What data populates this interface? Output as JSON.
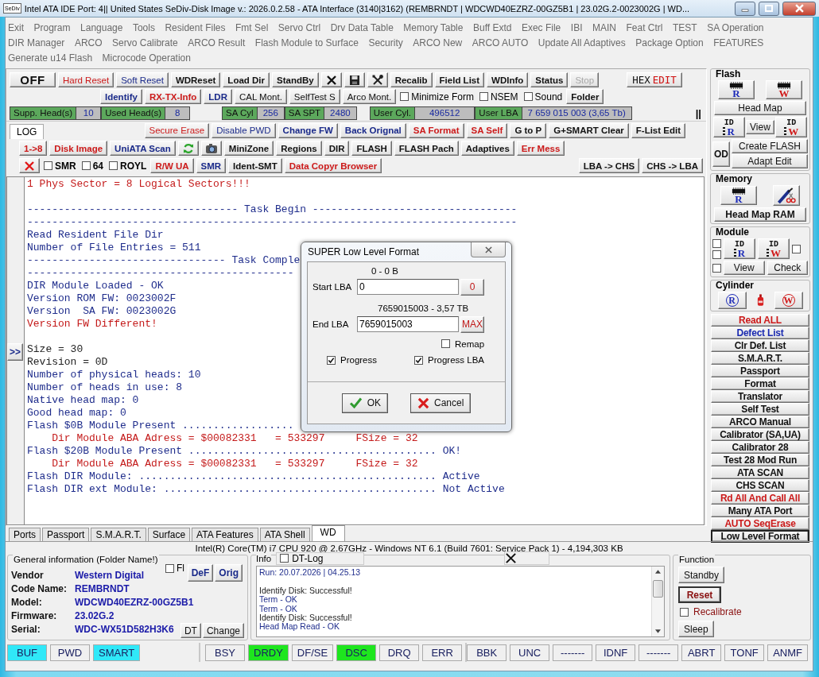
{
  "window": {
    "icon_label": "SeDiv",
    "title": "Intel ATA IDE  Port: 4|| United States  SeDiv-Disk Image v.: 2026.0.2.58 - ATA Interface (3140|3162)  (REMBRNDT | WDCWD40EZRZ-00GZ5B1 | 23.02G.2-0023002G | WD..."
  },
  "menu": [
    [
      "Exit",
      "Program",
      "Language",
      "Tools",
      "Resident Files",
      "Fmt Sel",
      "Servo Ctrl",
      "Drv Data Table",
      "Memory Table",
      "Buff Extd",
      "Exec File",
      "IBI",
      "MAIN",
      "Feat Ctrl",
      "TEST",
      "SA Operation"
    ],
    [
      "DIR Manager",
      "ARCO",
      "Servo Calibrate",
      "ARCO Result",
      "Flash Module to Surface",
      "Security",
      "ARCO New",
      "ARCO AUTO",
      "Update All Adaptives",
      "Package Option",
      "FEATURES"
    ],
    [
      "Generate u14 Flash",
      "Microcode Operation"
    ]
  ],
  "toolbar": [
    {
      "items": [
        {
          "kind": "button",
          "label": "OFF"
        },
        {
          "kind": "button",
          "label": "Hard Reset",
          "color": "#cc1a1a"
        },
        {
          "kind": "button",
          "label": "Soft Reset",
          "color": "#1a2a8a"
        },
        {
          "kind": "button",
          "label": "WDReset"
        },
        {
          "kind": "button",
          "label": "Load Dir"
        },
        {
          "kind": "button",
          "label": "StandBy"
        },
        {
          "kind": "cross"
        },
        {
          "kind": "disk"
        },
        {
          "kind": "tools"
        },
        {
          "kind": "button",
          "label": "Recalib"
        },
        {
          "kind": "button",
          "label": "Field List"
        },
        {
          "kind": "button",
          "label": "WDInfo"
        },
        {
          "kind": "button",
          "label": "Status"
        },
        {
          "kind": "button",
          "label": "Stop",
          "color": "#a8a8a8"
        },
        {
          "kind": "button",
          "label": "HEX",
          "accent": "EDIT"
        }
      ]
    },
    {
      "items": [
        {
          "kind": "button",
          "label": "Identify",
          "color": "#1a2a8a"
        },
        {
          "kind": "button",
          "label": "RX-TX-Info",
          "color": "#cc1a1a"
        },
        {
          "kind": "button",
          "label": "LDR",
          "color": "#1a2a8a"
        },
        {
          "kind": "button",
          "label": "CAL Mont."
        },
        {
          "kind": "button",
          "label": "SelfTest S"
        },
        {
          "kind": "button",
          "label": "Arco Mont."
        },
        {
          "kind": "check",
          "label": "Minimize Form",
          "checked": false
        },
        {
          "kind": "check",
          "label": "NSEM",
          "checked": false
        },
        {
          "kind": "check",
          "label": "Sound",
          "checked": false
        },
        {
          "kind": "button",
          "label": "Folder"
        }
      ]
    },
    {
      "items": [
        {
          "kind": "reading",
          "label": "Supp. Head(s)",
          "value": "10"
        },
        {
          "kind": "reading",
          "label": "Used Head(s)",
          "value": "8"
        },
        {
          "kind": "reading",
          "label": "SA Cyl",
          "value": "256"
        },
        {
          "kind": "reading",
          "label": "SA SPT",
          "value": "2480"
        },
        {
          "kind": "reading",
          "label": "User Cyl.",
          "value": "496512"
        },
        {
          "kind": "reading",
          "label": "User LBA",
          "value": "7 659 015 003  (3,65 Tb)"
        },
        {
          "kind": "splitter",
          "label": "||"
        }
      ]
    },
    {
      "items": [
        {
          "kind": "tab",
          "label": "LOG",
          "selected": true
        },
        {
          "kind": "button",
          "label": "Secure Erase",
          "color": "#cc1a1a"
        },
        {
          "kind": "button",
          "label": "Disable PWD",
          "color": "#1a2a8a"
        },
        {
          "kind": "button",
          "label": "Change FW",
          "color": "#1a2a8a"
        },
        {
          "kind": "button",
          "label": "Back Orignal",
          "color": "#1a2a8a"
        },
        {
          "kind": "button",
          "label": "SA Format",
          "color": "#cc1a1a"
        },
        {
          "kind": "button",
          "label": "SA Self",
          "color": "#cc1a1a"
        },
        {
          "kind": "button",
          "label": "G to P"
        },
        {
          "kind": "button",
          "label": "G+SMART Clear"
        },
        {
          "kind": "button",
          "label": "F-List Edit"
        }
      ]
    },
    {
      "items": [
        {
          "kind": "button",
          "label": "1->8",
          "color": "#cc1a1a"
        },
        {
          "kind": "button",
          "label": "Disk Image",
          "color": "#cc1a1a"
        },
        {
          "kind": "button",
          "label": "UniATA Scan",
          "color": "#1a2a8a"
        },
        {
          "kind": "refresh"
        },
        {
          "kind": "camera"
        },
        {
          "kind": "button",
          "label": "MiniZone"
        },
        {
          "kind": "button",
          "label": "Regions"
        },
        {
          "kind": "button",
          "label": "DIR"
        },
        {
          "kind": "button",
          "label": "FLASH"
        },
        {
          "kind": "button",
          "label": "FLASH Pach"
        },
        {
          "kind": "button",
          "label": "Adaptives"
        },
        {
          "kind": "button",
          "label": "Err Mess",
          "color": "#cc1a1a"
        }
      ]
    },
    {
      "items": [
        {
          "kind": "red-cross"
        },
        {
          "kind": "check",
          "label": "SMR",
          "checked": false
        },
        {
          "kind": "check",
          "label": "64",
          "checked": false
        },
        {
          "kind": "check",
          "label": "ROYL",
          "checked": false
        },
        {
          "kind": "button",
          "label": "R/W UA",
          "color": "#cc1a1a"
        },
        {
          "kind": "button",
          "label": "SMR",
          "color": "#1a2a8a"
        },
        {
          "kind": "button",
          "label": "Ident-SMT"
        },
        {
          "kind": "button",
          "label": "Data Copyr Browser",
          "color": "#cc1a1a"
        },
        {
          "kind": "button",
          "label": "LBA -> CHS"
        },
        {
          "kind": "button",
          "label": "CHS -> LBA"
        }
      ]
    }
  ],
  "log": {
    "expand_button": ">>",
    "blocks": [
      [
        {
          "kind": "alert",
          "text": "1 Phys Sector = 8 Logical Sectors!!!"
        }
      ],
      [
        {
          "kind": "info",
          "text": "---------------------------------- Task Begin ---------------------------------"
        },
        {
          "kind": "info",
          "text": "-------------------------------------------------------------------------------"
        },
        {
          "kind": "info",
          "text": "Read Resident File Dir"
        },
        {
          "kind": "info",
          "text": "Number of File Entries = 511"
        },
        {
          "kind": "info",
          "text": "-------------------------------- Task Comple"
        },
        {
          "kind": "info",
          "text": "-------------------------------------------"
        },
        {
          "kind": "info",
          "text": "DIR Module Loaded - OK"
        },
        {
          "kind": "info",
          "text": "Version ROM FW: 0023002F"
        },
        {
          "kind": "info",
          "text": "Version  SA FW: 0023002G"
        },
        {
          "kind": "alert",
          "text": "Version FW Different!"
        }
      ],
      [
        {
          "kind": "plain",
          "text": "Size = 30"
        },
        {
          "kind": "plain",
          "text": "Revision = 0D"
        },
        {
          "kind": "info",
          "text": "Number of physical heads: 10"
        },
        {
          "kind": "info",
          "text": "Number of heads in use: 8"
        },
        {
          "kind": "info",
          "text": "Native head map: 0"
        },
        {
          "kind": "info",
          "text": "Good head map: 0"
        },
        {
          "kind": "info",
          "text": "Flash $0B Module Present .................."
        },
        {
          "kind": "alert",
          "text": "    Dir Module ABA Adress = $00082331   = 533297     FSize = 32"
        },
        {
          "kind": "info",
          "text": "Flash $20B Module Present ........................................ OK!"
        },
        {
          "kind": "alert",
          "text": "    Dir Module ABA Adress = $00082331   = 533297     FSize = 32"
        },
        {
          "kind": "info",
          "text": "Flash DIR Module: ................................................ Active"
        },
        {
          "kind": "info",
          "text": "Flash DIR ext Module: ............................................ Not Active"
        }
      ]
    ]
  },
  "side_panel": {
    "flash": {
      "title": "Flash",
      "read": "R",
      "write": "W",
      "head_map": "Head Map",
      "id_read": {
        "top": "ID",
        "letter": "R"
      },
      "view": "View",
      "id_write": {
        "top": "ID",
        "letter": "W"
      },
      "od": "OD",
      "create": "Create FLASH",
      "adapt": "Adapt Edit"
    },
    "memory": {
      "title": "Memory",
      "read": "R",
      "head_map": "Head Map RAM"
    },
    "module": {
      "title": "Module",
      "id_read": {
        "top": "ID",
        "letter": "R"
      },
      "id_write": {
        "top": "ID",
        "letter": "W"
      },
      "view": "View",
      "check": "Check",
      "checks": [
        {
          "checked": false
        },
        {
          "checked": false
        },
        {
          "checked": false
        },
        {
          "checked": false
        }
      ]
    },
    "cylinder": {
      "title": "Cylinder",
      "read": "R",
      "write": "W"
    },
    "buttons": [
      {
        "label": "Read ALL",
        "color": "#cc1a1a"
      },
      {
        "label": "Defect List",
        "color": "#1a2ab0"
      },
      {
        "label": "Clr Def. List"
      },
      {
        "label": "S.M.A.R.T."
      },
      {
        "label": "Passport"
      },
      {
        "label": "Format"
      },
      {
        "label": "Translator"
      },
      {
        "label": "Self Test"
      },
      {
        "label": "ARCO Manual"
      },
      {
        "label": "Calibrator (SA,UA)"
      },
      {
        "label": "Calibrator 28"
      },
      {
        "label": "Test 28 Mod Run"
      },
      {
        "label": "ATA SCAN"
      },
      {
        "label": "CHS SCAN"
      },
      {
        "label": "Rd All And Call All",
        "color": "#cc1a1a"
      },
      {
        "label": "Many ATA Port"
      }
    ],
    "bottom_buttons": [
      {
        "label": "AUTO SeqErase",
        "color": "#cc1a1a",
        "focused": false
      },
      {
        "label": "Low Level Format",
        "focused": true
      }
    ]
  },
  "dialog": {
    "title": "SUPER Low Level Format",
    "start": {
      "range": "0 - 0 B",
      "label": "Start LBA",
      "value": "0",
      "button": "0"
    },
    "end": {
      "range": "7659015003 - 3,57 TB",
      "label": "End LBA",
      "value": "7659015003",
      "button": "MAX"
    },
    "options": [
      {
        "label": "Remap",
        "checked": false
      },
      {
        "label": "Progress",
        "checked": true
      },
      {
        "label": "Progress LBA",
        "checked": true
      }
    ],
    "ok": "OK",
    "cancel": "Cancel"
  },
  "tabs": [
    {
      "label": "Ports",
      "selected": false
    },
    {
      "label": "Passport",
      "selected": false
    },
    {
      "label": "S.M.A.R.T.",
      "selected": false
    },
    {
      "label": "Surface",
      "selected": false
    },
    {
      "label": "ATA Features",
      "selected": false
    },
    {
      "label": "ATA Shell",
      "selected": false
    },
    {
      "label": "WD",
      "selected": true
    }
  ],
  "system_info": "Intel(R) Core(TM) i7 CPU 920  @ 2.67GHz - Windows NT 6.1 (Build 7601: Service Pack 1) -  4,194,303 KB",
  "general": {
    "title": "General information (Folder Name!)",
    "flag": {
      "label": "Fl",
      "checked": false
    },
    "buttons": [
      "DeF",
      "Orig"
    ],
    "fields": [
      {
        "label": "Vendor",
        "value": "Western Digital"
      },
      {
        "label": "Code Name:",
        "value": "REMBRNDT"
      },
      {
        "label": "Model:",
        "value": "WDCWD40EZRZ-00GZ5B1"
      },
      {
        "label": "Firmware:",
        "value": "23.02G.2"
      },
      {
        "label": "Serial:",
        "value": "WDC-WX51D582H3K6"
      }
    ],
    "serial_buttons": [
      "DT",
      "Change"
    ]
  },
  "info": {
    "title": "Info",
    "log_check": {
      "label": "DT-Log",
      "checked": false
    },
    "blocks": [
      [
        {
          "kind": "info",
          "text": "Run: 20.07.2026 | 04.25.13"
        }
      ],
      [
        {
          "kind": "plain",
          "text": "Identify Disk: Successful!"
        },
        {
          "kind": "info",
          "text": "Term - OK"
        },
        {
          "kind": "info",
          "text": "Term - OK"
        },
        {
          "kind": "plain",
          "text": "Identify Disk: Successful!"
        },
        {
          "kind": "info",
          "text": "Head Map Read - OK"
        }
      ]
    ]
  },
  "function": {
    "title": "Function",
    "standby": "Standby",
    "reset": "Reset",
    "recalibrate": {
      "label": "Recalibrate",
      "checked": false
    },
    "sleep": "Sleep"
  },
  "status": [
    [
      {
        "label": "BUF",
        "on": true
      },
      {
        "label": "PWD",
        "on": false
      },
      {
        "label": "SMART",
        "on": true
      }
    ],
    [
      {
        "label": "BSY",
        "on": false
      },
      {
        "label": "DRDY",
        "on": true
      },
      {
        "label": "DF/SE",
        "on": false
      },
      {
        "label": "DSC",
        "on": true
      },
      {
        "label": "DRQ",
        "on": false
      },
      {
        "label": "ERR",
        "on": false
      }
    ],
    [
      {
        "label": "BBK",
        "on": false
      },
      {
        "label": "UNC",
        "on": false
      },
      {
        "label": "-------",
        "on": false
      },
      {
        "label": "IDNF",
        "on": false
      },
      {
        "label": "-------",
        "on": false
      },
      {
        "label": "ABRT",
        "on": false
      },
      {
        "label": "TONF",
        "on": false
      },
      {
        "label": "ANMF",
        "on": false
      }
    ]
  ]
}
